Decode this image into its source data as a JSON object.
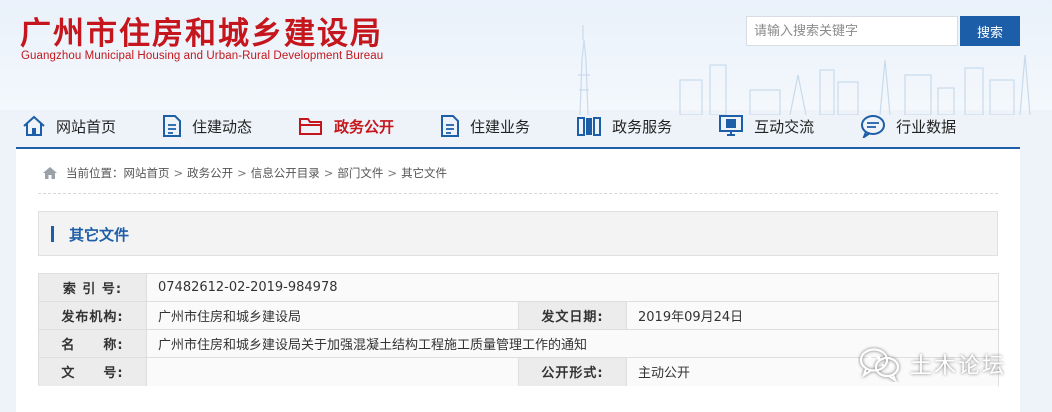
{
  "site": {
    "title_cn": "广州市住房和城乡建设局",
    "title_en": "Guangzhou Municipal Housing and Urban-Rural Development Bureau"
  },
  "search": {
    "placeholder": "请输入搜索关键字",
    "button": "搜索"
  },
  "nav": {
    "items": [
      {
        "label": "网站首页",
        "icon": "home-icon"
      },
      {
        "label": "住建动态",
        "icon": "document-icon"
      },
      {
        "label": "政务公开",
        "icon": "folder-icon",
        "active": true
      },
      {
        "label": "住建业务",
        "icon": "document-icon"
      },
      {
        "label": "政务服务",
        "icon": "books-icon"
      },
      {
        "label": "互动交流",
        "icon": "monitor-icon"
      },
      {
        "label": "行业数据",
        "icon": "chat-icon"
      }
    ]
  },
  "breadcrumb": {
    "prefix": "当前位置：",
    "items": [
      "网站首页",
      "政务公开",
      "信息公开目录",
      "部门文件"
    ],
    "current": "其它文件",
    "sep": ">"
  },
  "section": {
    "title": "其它文件"
  },
  "meta": {
    "index_label": "索 引 号:",
    "index_value": "07482612-02-2019-984978",
    "publisher_label": "发布机构:",
    "publisher_value": "广州市住房和城乡建设局",
    "date_label": "发文日期:",
    "date_value": "2019年09月24日",
    "name_label": "名　　称:",
    "name_value": "广州市住房和城乡建设局关于加强混凝土结构工程施工质量管理工作的通知",
    "docno_label": "文　　号:",
    "docno_value": "",
    "form_label": "公开形式:",
    "form_value": "主动公开"
  },
  "watermark": {
    "text": "土木论坛",
    "icon": "wechat-icon"
  },
  "colors": {
    "brand_red": "#c4161c",
    "brand_blue": "#1d5ea8"
  }
}
